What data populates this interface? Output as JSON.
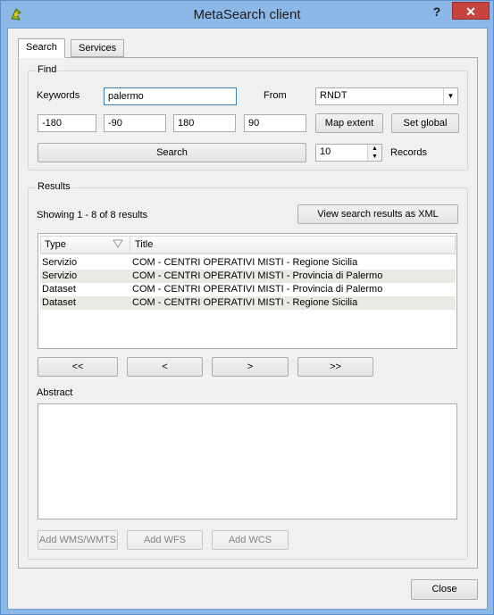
{
  "window": {
    "title": "MetaSearch client",
    "help_label": "?",
    "close_label": "✕"
  },
  "tabs": [
    {
      "label": "Search"
    },
    {
      "label": "Services"
    }
  ],
  "find": {
    "group_title": "Find",
    "keywords_label": "Keywords",
    "keywords_value": "palermo",
    "from_label": "From",
    "from_value": "RNDT",
    "bbox": [
      "-180",
      "-90",
      "180",
      "90"
    ],
    "map_extent_label": "Map extent",
    "set_global_label": "Set global",
    "search_label": "Search",
    "records_value": "10",
    "records_label": "Records"
  },
  "results": {
    "group_title": "Results",
    "summary": "Showing 1 - 8 of 8 results",
    "view_xml_label": "View search results as XML",
    "columns": {
      "type": "Type",
      "title": "Title"
    },
    "rows": [
      {
        "type": "Servizio",
        "title": "COM - CENTRI OPERATIVI MISTI - Regione Sicilia"
      },
      {
        "type": "Servizio",
        "title": "COM - CENTRI OPERATIVI MISTI - Provincia di Palermo"
      },
      {
        "type": "Dataset",
        "title": "COM - CENTRI OPERATIVI MISTI - Provincia di Palermo"
      },
      {
        "type": "Dataset",
        "title": "COM - CENTRI OPERATIVI MISTI - Regione Sicilia"
      }
    ],
    "nav": {
      "first": "<<",
      "prev": "<",
      "next": ">",
      "last": ">>"
    },
    "abstract_label": "Abstract",
    "add_wms_label": "Add WMS/WMTS",
    "add_wfs_label": "Add WFS",
    "add_wcs_label": "Add WCS"
  },
  "footer": {
    "close_label": "Close"
  },
  "colors": {
    "titlebar": "#8cb8e8",
    "close_button": "#c7433d",
    "row_alt": "#ebe9e3"
  }
}
